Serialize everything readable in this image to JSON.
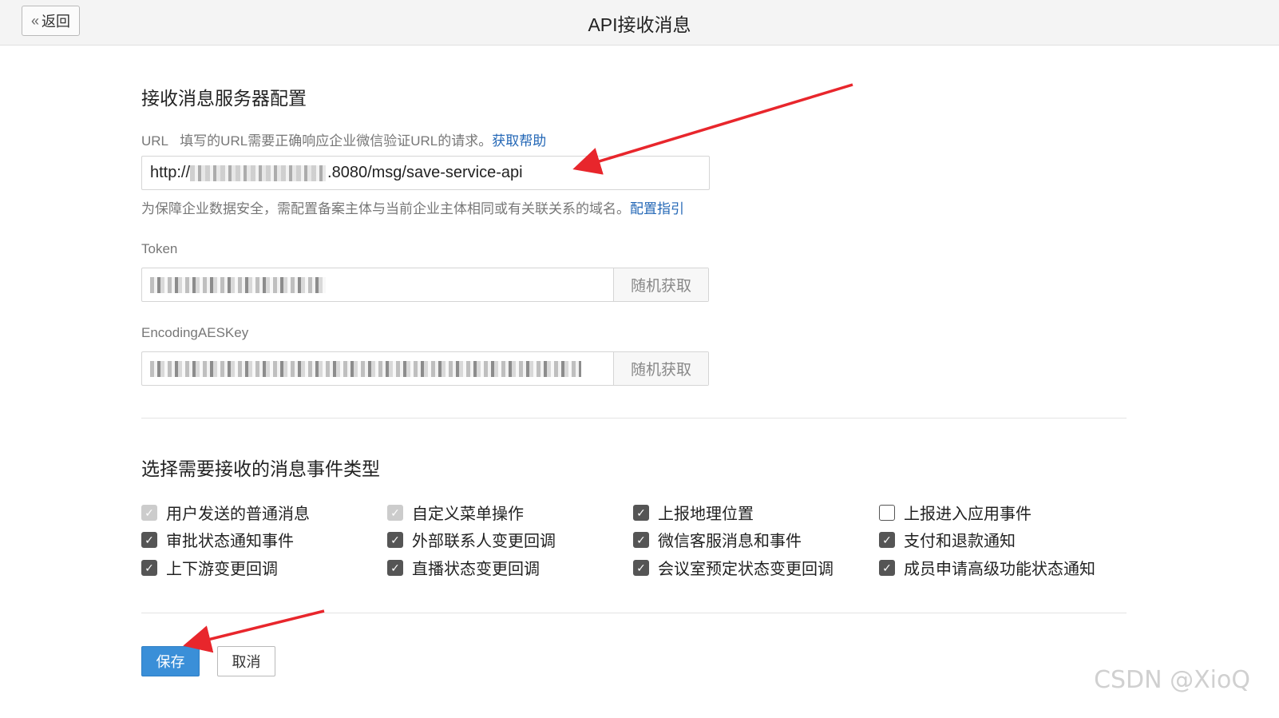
{
  "header": {
    "back_label": "返回",
    "back_icon": "«",
    "title": "API接收消息"
  },
  "server_config": {
    "section_title": "接收消息服务器配置",
    "url": {
      "label": "URL",
      "hint": "填写的URL需要正确响应企业微信验证URL的请求。",
      "help_link": "获取帮助",
      "value_prefix": "http://",
      "value_suffix": ".8080/msg/save-service-api",
      "security_hint": "为保障企业数据安全，需配置备案主体与当前企业主体相同或有关联关系的域名。",
      "guide_link": "配置指引"
    },
    "token": {
      "label": "Token",
      "button": "随机获取"
    },
    "aes_key": {
      "label": "EncodingAESKey",
      "button": "随机获取"
    }
  },
  "events": {
    "section_title": "选择需要接收的消息事件类型",
    "items": [
      {
        "label": "用户发送的普通消息",
        "state": "disabled"
      },
      {
        "label": "自定义菜单操作",
        "state": "disabled"
      },
      {
        "label": "上报地理位置",
        "state": "checked"
      },
      {
        "label": "上报进入应用事件",
        "state": "unchecked"
      },
      {
        "label": "审批状态通知事件",
        "state": "checked"
      },
      {
        "label": "外部联系人变更回调",
        "state": "checked"
      },
      {
        "label": "微信客服消息和事件",
        "state": "checked"
      },
      {
        "label": "支付和退款通知",
        "state": "checked"
      },
      {
        "label": "上下游变更回调",
        "state": "checked"
      },
      {
        "label": "直播状态变更回调",
        "state": "checked"
      },
      {
        "label": "会议室预定状态变更回调",
        "state": "checked"
      },
      {
        "label": "成员申请高级功能状态通知",
        "state": "checked"
      }
    ]
  },
  "footer": {
    "save_label": "保存",
    "cancel_label": "取消"
  },
  "watermark": "CSDN @XioQ",
  "colors": {
    "primary": "#3a8fd8",
    "link": "#2367b6",
    "annotation_arrow": "#e8262c"
  }
}
